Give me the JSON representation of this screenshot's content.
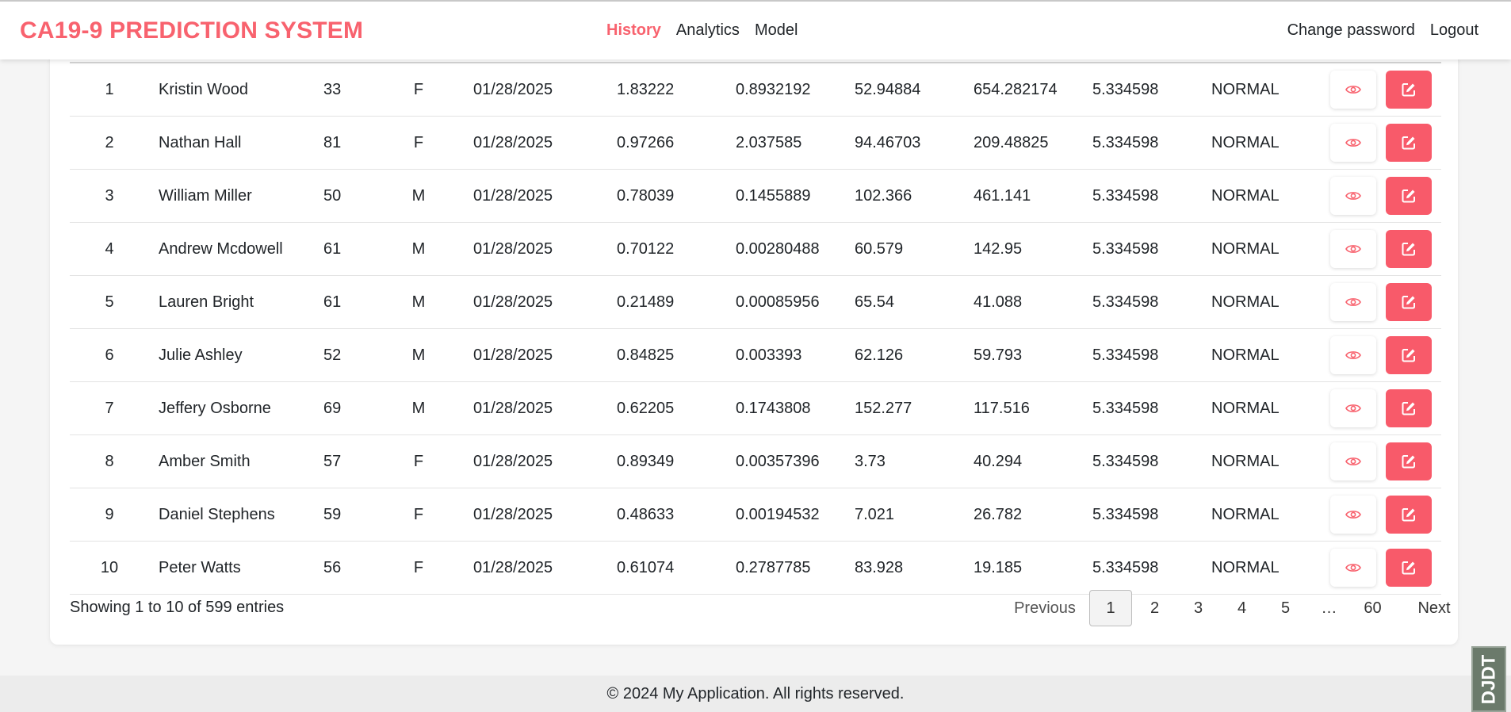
{
  "header": {
    "brand": "CA19-9 PREDICTION SYSTEM",
    "nav": [
      {
        "label": "History",
        "active": true
      },
      {
        "label": "Analytics",
        "active": false
      },
      {
        "label": "Model",
        "active": false
      }
    ],
    "change_password": "Change password",
    "logout": "Logout"
  },
  "rows": [
    {
      "no": "1",
      "name": "Kristin Wood",
      "age": "33",
      "sex": "F",
      "date": "01/28/2025",
      "v1": "1.83222",
      "v2": "0.8932192",
      "v3": "52.94884",
      "v4": "654.282174",
      "v5": "5.334598",
      "status": "NORMAL"
    },
    {
      "no": "2",
      "name": "Nathan Hall",
      "age": "81",
      "sex": "F",
      "date": "01/28/2025",
      "v1": "0.97266",
      "v2": "2.037585",
      "v3": "94.46703",
      "v4": "209.48825",
      "v5": "5.334598",
      "status": "NORMAL"
    },
    {
      "no": "3",
      "name": "William Miller",
      "age": "50",
      "sex": "M",
      "date": "01/28/2025",
      "v1": "0.78039",
      "v2": "0.1455889",
      "v3": "102.366",
      "v4": "461.141",
      "v5": "5.334598",
      "status": "NORMAL"
    },
    {
      "no": "4",
      "name": "Andrew Mcdowell",
      "age": "61",
      "sex": "M",
      "date": "01/28/2025",
      "v1": "0.70122",
      "v2": "0.00280488",
      "v3": "60.579",
      "v4": "142.95",
      "v5": "5.334598",
      "status": "NORMAL"
    },
    {
      "no": "5",
      "name": "Lauren Bright",
      "age": "61",
      "sex": "M",
      "date": "01/28/2025",
      "v1": "0.21489",
      "v2": "0.00085956",
      "v3": "65.54",
      "v4": "41.088",
      "v5": "5.334598",
      "status": "NORMAL"
    },
    {
      "no": "6",
      "name": "Julie Ashley",
      "age": "52",
      "sex": "M",
      "date": "01/28/2025",
      "v1": "0.84825",
      "v2": "0.003393",
      "v3": "62.126",
      "v4": "59.793",
      "v5": "5.334598",
      "status": "NORMAL"
    },
    {
      "no": "7",
      "name": "Jeffery Osborne",
      "age": "69",
      "sex": "M",
      "date": "01/28/2025",
      "v1": "0.62205",
      "v2": "0.1743808",
      "v3": "152.277",
      "v4": "117.516",
      "v5": "5.334598",
      "status": "NORMAL"
    },
    {
      "no": "8",
      "name": "Amber Smith",
      "age": "57",
      "sex": "F",
      "date": "01/28/2025",
      "v1": "0.89349",
      "v2": "0.00357396",
      "v3": "3.73",
      "v4": "40.294",
      "v5": "5.334598",
      "status": "NORMAL"
    },
    {
      "no": "9",
      "name": "Daniel Stephens",
      "age": "59",
      "sex": "F",
      "date": "01/28/2025",
      "v1": "0.48633",
      "v2": "0.00194532",
      "v3": "7.021",
      "v4": "26.782",
      "v5": "5.334598",
      "status": "NORMAL"
    },
    {
      "no": "10",
      "name": "Peter Watts",
      "age": "56",
      "sex": "F",
      "date": "01/28/2025",
      "v1": "0.61074",
      "v2": "0.2787785",
      "v3": "83.928",
      "v4": "19.185",
      "v5": "5.334598",
      "status": "NORMAL"
    }
  ],
  "table_footer": {
    "info": "Showing 1 to 10 of 599 entries"
  },
  "pagination": {
    "previous": "Previous",
    "pages": [
      "1",
      "2",
      "3",
      "4",
      "5"
    ],
    "active_page": "1",
    "ellipsis": "…",
    "last": "60",
    "next": "Next"
  },
  "footer": {
    "text": "© 2024 My Application. All rights reserved."
  },
  "watermark": {
    "text": "DJDT"
  },
  "colors": {
    "accent": "#f8626e",
    "edit_button": "#f85a6a"
  },
  "icons": {
    "view": "eye-icon",
    "edit": "edit-icon"
  }
}
